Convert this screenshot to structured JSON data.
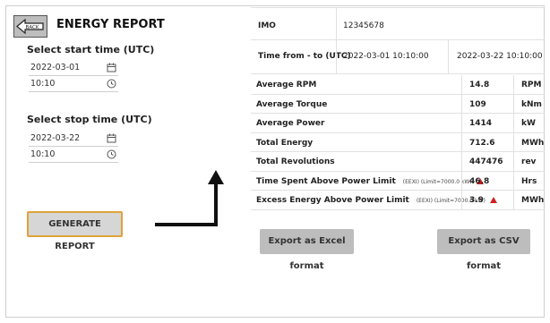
{
  "header": {
    "back_label": "BACK",
    "title": "ENERGY REPORT"
  },
  "start": {
    "label": "Select start time (UTC)",
    "date": "2022-03-01",
    "time": "10:10"
  },
  "stop": {
    "label": "Select stop time (UTC)",
    "date": "2022-03-22",
    "time": "10:10"
  },
  "generate_label": "GENERATE REPORT",
  "info": {
    "imo_label": "IMO",
    "imo_value": "12345678",
    "time_label": "Time from - to (UTC)",
    "time_from": "2022-03-01 10:10:00",
    "time_to": "2022-03-22 10:10:00"
  },
  "metrics": [
    {
      "label": "Average RPM",
      "value": "14.8",
      "unit": "RPM"
    },
    {
      "label": "Average Torque",
      "value": "109",
      "unit": "kNm"
    },
    {
      "label": "Average Power",
      "value": "1414",
      "unit": "kW"
    },
    {
      "label": "Total Energy",
      "value": "712.6",
      "unit": "MWh"
    },
    {
      "label": "Total Revolutions",
      "value": "447476",
      "unit": "rev"
    },
    {
      "label": "Time Spent Above Power Limit",
      "note": "(EEXI) (Limit=7000.0 kW)",
      "value": "46.8",
      "unit": "Hrs"
    },
    {
      "label": "Excess Energy Above Power Limit",
      "note": "(EEXI) (Limit=7000.0 kW)",
      "value": "3.9",
      "unit": "MWh"
    }
  ],
  "export": {
    "excel_label": "Export as Excel format",
    "csv_label": "Export as CSV format"
  },
  "colors": {
    "warning": "#d21f1f",
    "button_border": "#e0a23a"
  }
}
